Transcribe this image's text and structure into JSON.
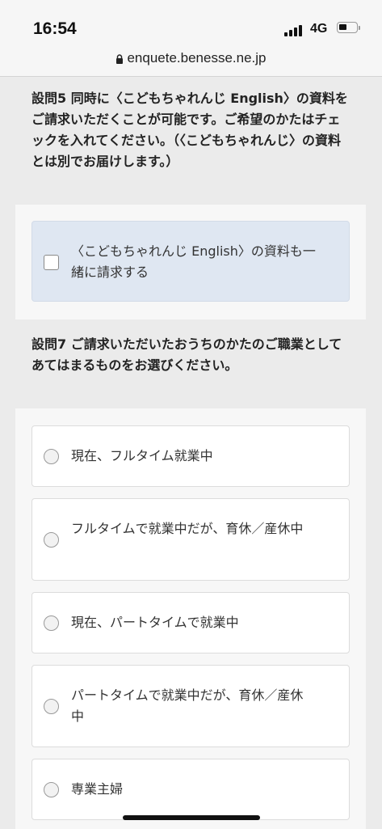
{
  "status_bar": {
    "time": "16:54",
    "network": "4G"
  },
  "browser": {
    "url": "enquete.benesse.ne.jp"
  },
  "question5": {
    "text": "設問5 同時に〈こどもちゃれんじ English〉の資料をご請求いただくことが可能です。ご希望のかたはチェックを入れてください。（〈こどもちゃれんじ〉の資料とは別でお届けします。）",
    "option": "〈こどもちゃれんじ English〉の資料も一緒に請求する"
  },
  "question7": {
    "text": "設問7 ご請求いただいたおうちのかたのご職業としてあてはまるものをお選びください。",
    "options": [
      "現在、フルタイム就業中",
      "フルタイムで就業中だが、育休／産休中",
      "現在、パートタイムで就業中",
      "パートタイムで就業中だが、育休／産休中",
      "専業主婦"
    ]
  }
}
